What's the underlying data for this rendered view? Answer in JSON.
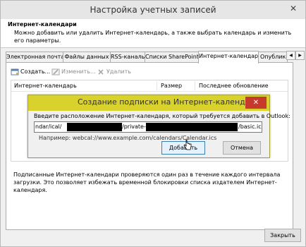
{
  "window": {
    "title": "Настройка учетных записей",
    "close_glyph": "✕"
  },
  "header": {
    "title": "Интернет-календари",
    "description": "Можно добавить или удалить Интернет-календарь, а также выбрать календарь и изменить его параметры."
  },
  "tabs": [
    {
      "label": "Электронная почта"
    },
    {
      "label": "Файлы данных"
    },
    {
      "label": "RSS-каналы"
    },
    {
      "label": "Списки SharePoint"
    },
    {
      "label": "Интернет-календари"
    },
    {
      "label": "Опублико"
    }
  ],
  "tab_nav": {
    "prev": "◀",
    "next": "▶"
  },
  "toolbar": {
    "create": "Создать...",
    "edit": "Изменить...",
    "delete": "Удалить"
  },
  "grid": {
    "columns": [
      "Интернет-календарь",
      "Размер",
      "Последнее обновление"
    ]
  },
  "info_text": "Подписанные Интернет-календари проверяются один раз в течение каждого интервала загрузки. Это позволяет избежать временной блокировки списка издателем Интернет-календаря.",
  "close_button": "Закрыть",
  "dialog": {
    "title": "Создание подписки на Интернет-календарь",
    "close_glyph": "✕",
    "label": "Введите расположение Интернет-календаря, который требуется добавить в Outlook:",
    "url_parts": [
      "ndar/ical/",
      "/private-",
      "/basic.ics"
    ],
    "example": "Например: webcal://www.example.com/calendars/Calendar.ics",
    "add_button": "Добавить",
    "cancel_button": "Отмена"
  },
  "colors": {
    "dialog_title_bg": "#d9d12c",
    "dialog_close_bg": "#c7392b"
  }
}
